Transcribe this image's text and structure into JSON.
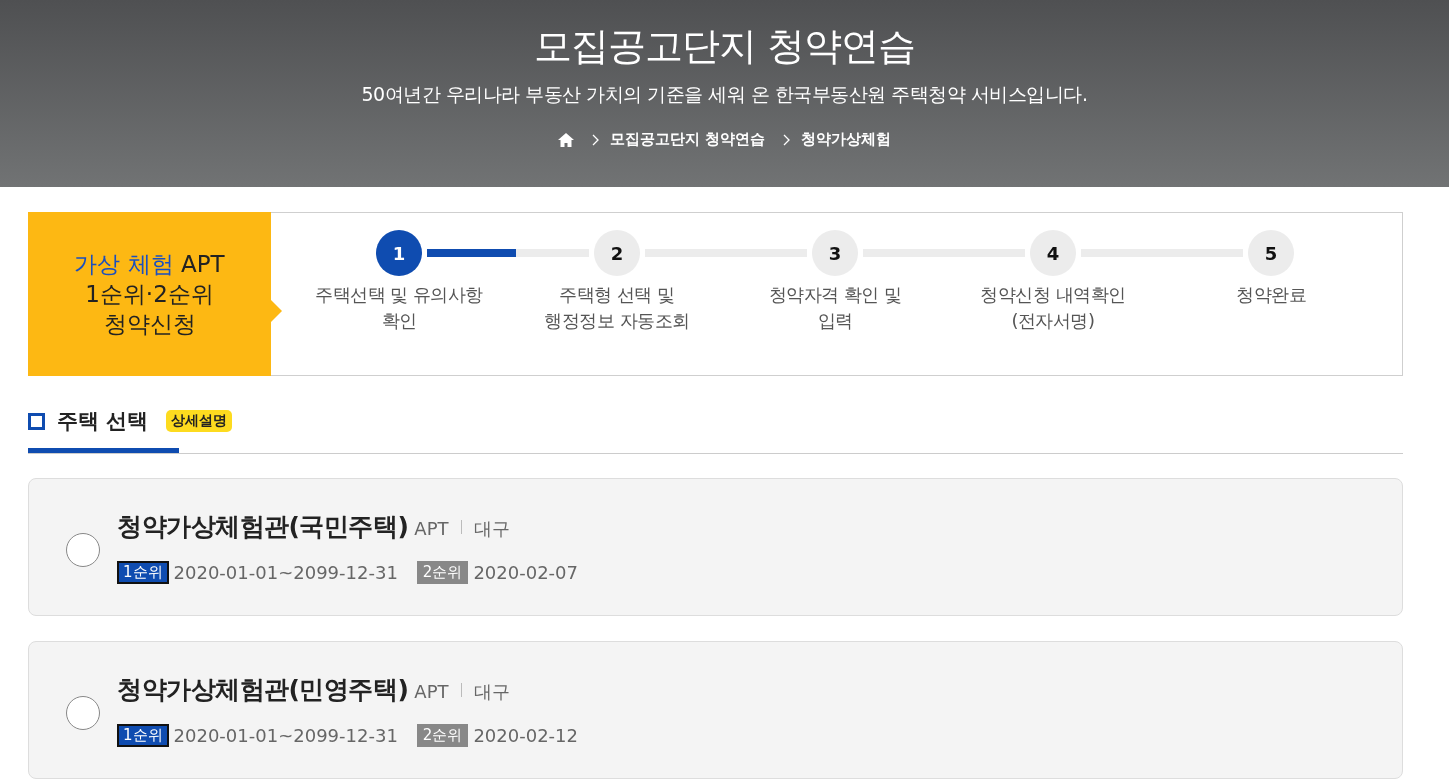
{
  "header": {
    "title": "모집공고단지 청약연습",
    "subtitle": "50여년간 우리나라 부동산 가치의 기준을 세워 온 한국부동산원 주택청약 서비스입니다.",
    "breadcrumb": [
      "모집공고단지 청약연습",
      "청약가상체험"
    ]
  },
  "stepper": {
    "label_highlight": "가상 체험",
    "label_rest": "APT",
    "label_lines": [
      "1순위·2순위",
      "청약신청"
    ],
    "steps": [
      {
        "number": "1",
        "label": [
          "주택선택 및 유의사항",
          "확인"
        ],
        "selected": true
      },
      {
        "number": "2",
        "label": [
          "주택형 선택 및",
          "행정정보 자동조회"
        ],
        "selected": false
      },
      {
        "number": "3",
        "label": [
          "청약자격 확인 및",
          "입력"
        ],
        "selected": false
      },
      {
        "number": "4",
        "label": [
          "청약신청 내역확인",
          "(전자서명)"
        ],
        "selected": false
      },
      {
        "number": "5",
        "label": [
          "청약완료"
        ],
        "selected": false
      }
    ]
  },
  "section": {
    "title": "주택 선택",
    "badge": "상세설명"
  },
  "complexes": [
    {
      "name": "청약가상체험관(국민주택)",
      "type": "APT",
      "region": "대구",
      "selected": false,
      "rounds": [
        {
          "kind": "first",
          "label": "1순위",
          "period": "2020-01-01~2099-12-31"
        },
        {
          "kind": "second",
          "label": "2순위",
          "period": "2020-02-07"
        }
      ]
    },
    {
      "name": "청약가상체험관(민영주택)",
      "type": "APT",
      "region": "대구",
      "selected": false,
      "rounds": [
        {
          "kind": "first",
          "label": "1순위",
          "period": "2020-01-01~2099-12-31"
        },
        {
          "kind": "second",
          "label": "2순위",
          "period": "2020-02-12"
        }
      ]
    }
  ]
}
